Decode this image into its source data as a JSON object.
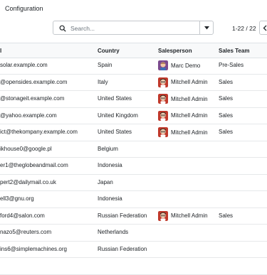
{
  "breadcrumb": {
    "title": "Configuration"
  },
  "search": {
    "placeholder": "Search..."
  },
  "pager": {
    "value": "1-22 / 22"
  },
  "columns": {
    "email": "l",
    "country": "Country",
    "salesperson": "Salesperson",
    "sales_team": "Sales Team"
  },
  "rows": [
    {
      "email": "solar.example.com",
      "country": "Spain",
      "salesperson": "Marc Demo",
      "team": "Pre-Sales",
      "avatar": "marc"
    },
    {
      "email": "@opensides.example.com",
      "country": "Italy",
      "salesperson": "Mitchell Admin",
      "team": "Sales",
      "avatar": "mitchell"
    },
    {
      "email": "@stonageit.example.com",
      "country": "United States",
      "salesperson": "Mitchell Admin",
      "team": "Sales",
      "avatar": "mitchell"
    },
    {
      "email": "@yahoo.example.com",
      "country": "United Kingdom",
      "salesperson": "Mitchell Admin",
      "team": "Sales",
      "avatar": "mitchell"
    },
    {
      "email": "ict@thekompany.example.com",
      "country": "United States",
      "salesperson": "Mitchell Admin",
      "team": "Sales",
      "avatar": "mitchell"
    },
    {
      "email": "ikhouse0@google.pl",
      "country": "Belgium",
      "salesperson": "",
      "team": "",
      "avatar": ""
    },
    {
      "email": "er1@theglobeandmail.com",
      "country": "Indonesia",
      "salesperson": "",
      "team": "",
      "avatar": ""
    },
    {
      "email": "pert2@dailymail.co.uk",
      "country": "Japan",
      "salesperson": "",
      "team": "",
      "avatar": ""
    },
    {
      "email": "ell3@gnu.org",
      "country": "Indonesia",
      "salesperson": "",
      "team": "",
      "avatar": ""
    },
    {
      "email": "ford4@salon.com",
      "country": "Russian Federation",
      "salesperson": "Mitchell Admin",
      "team": "Sales",
      "avatar": "mitchell"
    },
    {
      "email": "nazo5@reuters.com",
      "country": "Netherlands",
      "salesperson": "",
      "team": "",
      "avatar": ""
    },
    {
      "email": "ins6@simplemachines.org",
      "country": "Russian Federation",
      "salesperson": "",
      "team": "",
      "avatar": ""
    },
    {
      "email": "",
      "country": "",
      "salesperson": "",
      "team": "",
      "avatar": ""
    }
  ],
  "colors": {
    "marc_avatar": "#7b4a8e",
    "mitchell_avatar": "#c0392b"
  }
}
